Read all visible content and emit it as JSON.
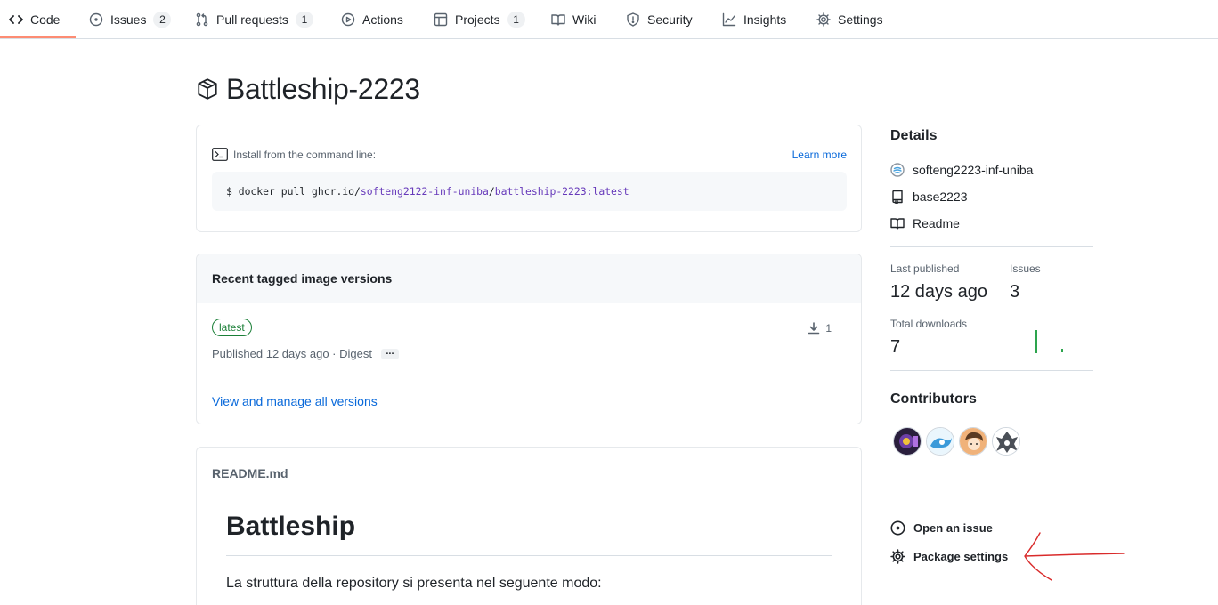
{
  "nav": {
    "tabs": [
      {
        "label": "Code",
        "icon": "code-icon",
        "count": null
      },
      {
        "label": "Issues",
        "icon": "issue-opened-icon",
        "count": "2"
      },
      {
        "label": "Pull requests",
        "icon": "git-pull-request-icon",
        "count": "1"
      },
      {
        "label": "Actions",
        "icon": "play-icon",
        "count": null
      },
      {
        "label": "Projects",
        "icon": "table-icon",
        "count": "1"
      },
      {
        "label": "Wiki",
        "icon": "book-icon",
        "count": null
      },
      {
        "label": "Security",
        "icon": "shield-icon",
        "count": null
      },
      {
        "label": "Insights",
        "icon": "graph-icon",
        "count": null
      },
      {
        "label": "Settings",
        "icon": "gear-icon",
        "count": null
      }
    ],
    "active_tab": "Code",
    "accent_color": "#fd8c73"
  },
  "package": {
    "title": "Battleship-2223"
  },
  "install": {
    "header": "Install from the command line:",
    "learn_more": "Learn more",
    "cmd_prefix": "$ docker pull ghcr.io/",
    "cmd_owner": "softeng2122-inf-uniba",
    "cmd_slash": "/",
    "cmd_image": "battleship-2223",
    "cmd_tag": ":latest"
  },
  "versions": {
    "header": "Recent tagged image versions",
    "tag": "latest",
    "downloads": "1",
    "published": "Published 12 days ago · Digest",
    "more_label": "...",
    "view_all": "View and manage all versions"
  },
  "readme": {
    "filename": "README.md",
    "heading": "Battleship",
    "paragraph": "La struttura della repository si presenta nel seguente modo:"
  },
  "sidebar": {
    "details_title": "Details",
    "owner": "softeng2223-inf-uniba",
    "repo": "base2223",
    "readme_link": "Readme",
    "last_published_label": "Last published",
    "last_published_value": "12 days ago",
    "issues_label": "Issues",
    "issues_value": "3",
    "total_downloads_label": "Total downloads",
    "total_downloads_value": "7",
    "contributors_title": "Contributors",
    "contributors": [
      {
        "name": "contributor-1",
        "color": "#5b3e8f"
      },
      {
        "name": "contributor-2",
        "color": "#4aa3df"
      },
      {
        "name": "contributor-3",
        "color": "#e0a36b"
      },
      {
        "name": "contributor-4",
        "color": "#8a8f98"
      }
    ],
    "open_issue": "Open an issue",
    "package_settings": "Package settings"
  },
  "annotation": {
    "arrow_color": "#d92b2b"
  }
}
